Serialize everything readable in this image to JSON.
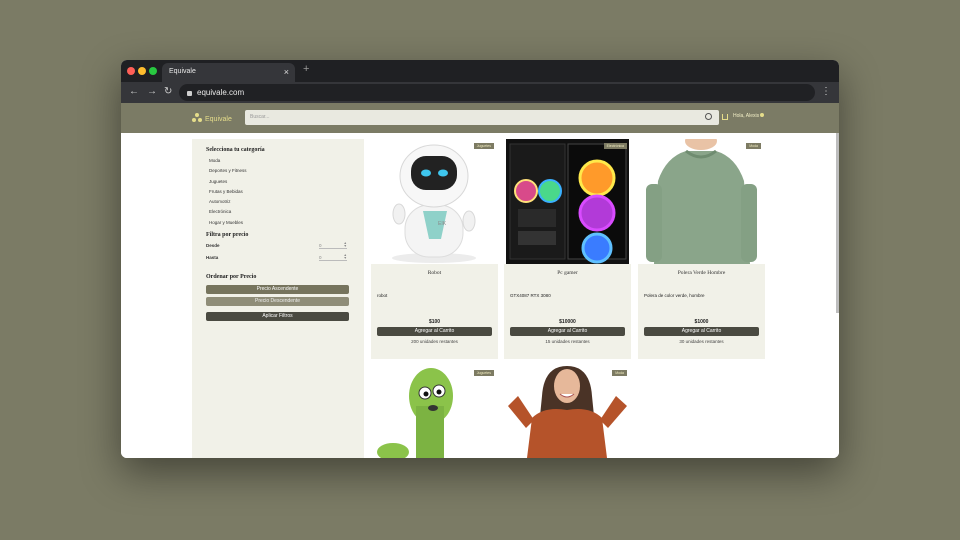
{
  "browser": {
    "tab_title": "Equivale",
    "tab_close": "×",
    "new_tab": "+",
    "url": "equivale.com"
  },
  "site": {
    "brand": "Equivale",
    "search_placeholder": "Buscar...",
    "greeting": "Hola, Alexis"
  },
  "sidebar": {
    "category_title": "Selecciona tu categoría",
    "categories": [
      "Moda",
      "Deportes y Fitness",
      "Juguetes",
      "Frutas y Bebidas",
      "Automotriz",
      "Electrónica",
      "Hogar y Muebles"
    ],
    "filter_title": "Filtra por precio",
    "from_label": "Desde",
    "from_value": "0",
    "to_label": "Hasta",
    "to_value": "0",
    "sort_title": "Ordenar por Precio",
    "sort_asc": "Precio Ascendente",
    "sort_desc": "Precio Descendente",
    "apply": "Aplicar Filtros"
  },
  "products": [
    {
      "tag": "Juguetes",
      "name": "Robot",
      "desc": "robot",
      "price": "$100",
      "cta": "Agregar al Carrito",
      "stock": "200 unidades restantes"
    },
    {
      "tag": "Electrónica",
      "name": "Pc gamer",
      "desc": "GTX4087 RTX 3080",
      "price": "$10000",
      "cta": "Agregar al Carrito",
      "stock": "15 unidades restantes"
    },
    {
      "tag": "Moda",
      "name": "Polera Verde Hombre",
      "desc": "Polera de color verde, hombre",
      "price": "$1000",
      "cta": "Agregar al Carrito",
      "stock": "30 unidades restantes"
    },
    {
      "tag": "Juguetes"
    },
    {
      "tag": "Moda"
    }
  ],
  "colors": {
    "accent": "#7b7b65",
    "brand_yellow": "#e5dd8a",
    "button_dark": "#4a4a41"
  }
}
